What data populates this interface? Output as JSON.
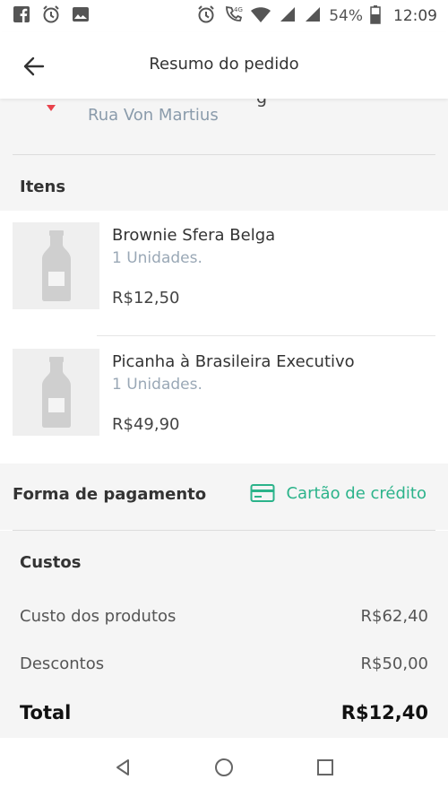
{
  "status_bar": {
    "battery": "54%",
    "time": "12:09",
    "network": "4G",
    "icons": [
      "facebook-icon",
      "alarm-icon",
      "image-icon",
      "alarm-icon",
      "phone-4g-icon",
      "wifi-icon",
      "signal-icon",
      "signal-icon",
      "battery-icon"
    ]
  },
  "header": {
    "title": "Resumo do pedido",
    "back_icon": "arrow-left-icon"
  },
  "address": {
    "partial_top_text": "g",
    "street": "Rua Von Martius",
    "pin_color": "#e8424b"
  },
  "items_section": {
    "label": "Itens",
    "items": [
      {
        "name": "Brownie Sfera Belga",
        "quantity": "1 Unidades.",
        "price": "R$12,50",
        "image_icon": "bottle-placeholder-icon"
      },
      {
        "name": "Picanha à Brasileira Executivo",
        "quantity": "1 Unidades.",
        "price": "R$49,90",
        "image_icon": "bottle-placeholder-icon"
      }
    ]
  },
  "payment": {
    "label": "Forma de pagamento",
    "method": "Cartão de crédito",
    "method_icon": "credit-card-icon",
    "accent_color": "#2bb38a"
  },
  "costs": {
    "label": "Custos",
    "rows": [
      {
        "label": "Custo dos produtos",
        "value": "R$62,40"
      },
      {
        "label": "Descontos",
        "value": "R$50,00"
      }
    ],
    "total_label": "Total",
    "total_value": "R$12,40"
  },
  "navbar": {
    "icons": [
      "nav-back-icon",
      "nav-home-icon",
      "nav-recents-icon"
    ]
  }
}
